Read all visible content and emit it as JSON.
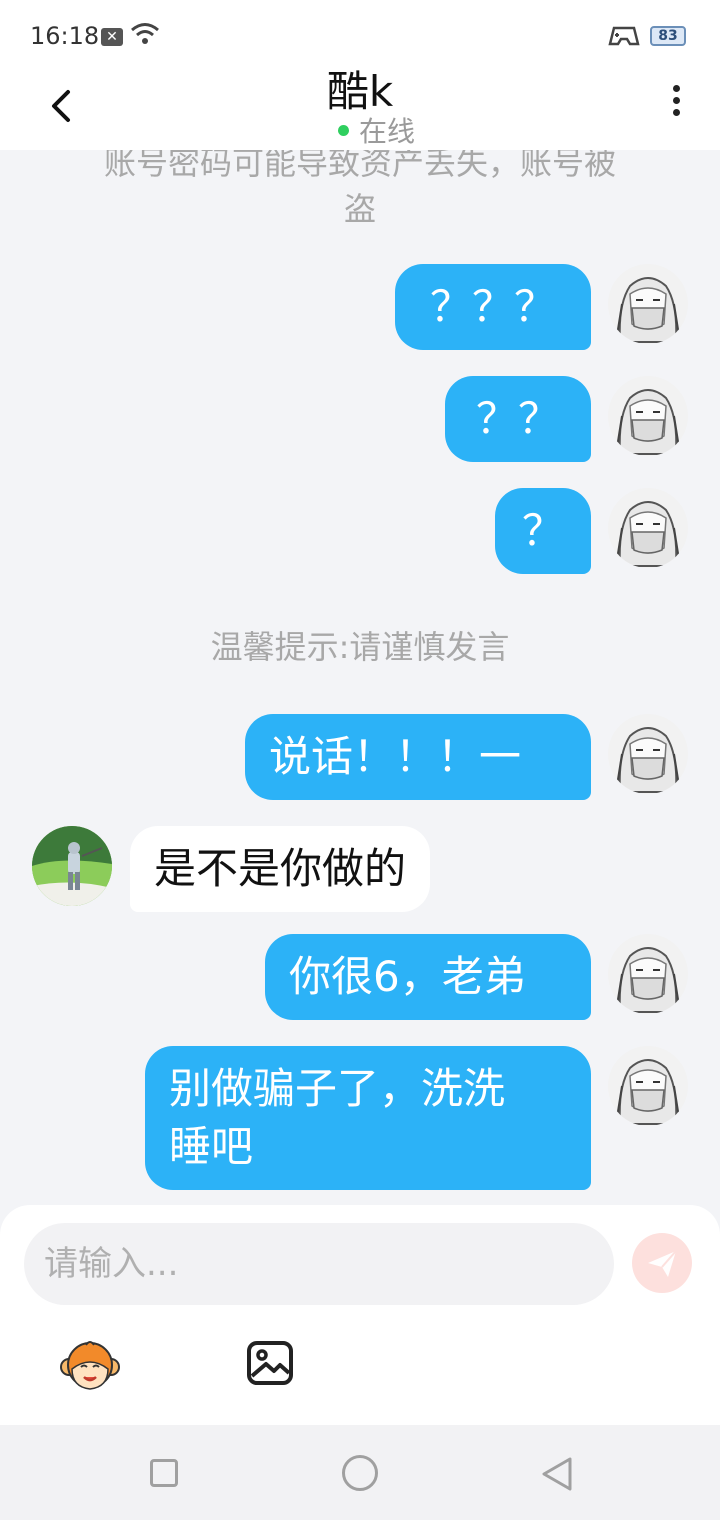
{
  "status_bar": {
    "time": "16:18",
    "notification_icon": "close-box-icon",
    "battery_level": "83"
  },
  "header": {
    "title": "酷k",
    "status": "在线"
  },
  "messages": [
    {
      "type": "system",
      "text": "账号密码可能导致资产丢失，账号被\n盗"
    },
    {
      "type": "outgoing",
      "text": "？？？"
    },
    {
      "type": "outgoing",
      "text": "？？"
    },
    {
      "type": "outgoing",
      "text": "？"
    },
    {
      "type": "system",
      "text": "温馨提示:请谨慎发言"
    },
    {
      "type": "outgoing",
      "text": "说话！！！一"
    },
    {
      "type": "incoming",
      "text": "是不是你做的"
    },
    {
      "type": "outgoing",
      "text": "你很6，老弟"
    },
    {
      "type": "outgoing",
      "text": "别做骗子了，洗洗\n睡吧"
    }
  ],
  "input": {
    "placeholder": "请输入..."
  },
  "colors": {
    "outgoing_bubble": "#2cb2f7",
    "incoming_bubble": "#ffffff",
    "online_dot": "#2fcf5f",
    "send_button": "#f4a090"
  },
  "icons": {
    "back": "chevron-left-icon",
    "more": "more-vertical-icon",
    "send": "paper-plane-icon",
    "sticker": "monkey-sticker-icon",
    "image": "image-icon"
  }
}
